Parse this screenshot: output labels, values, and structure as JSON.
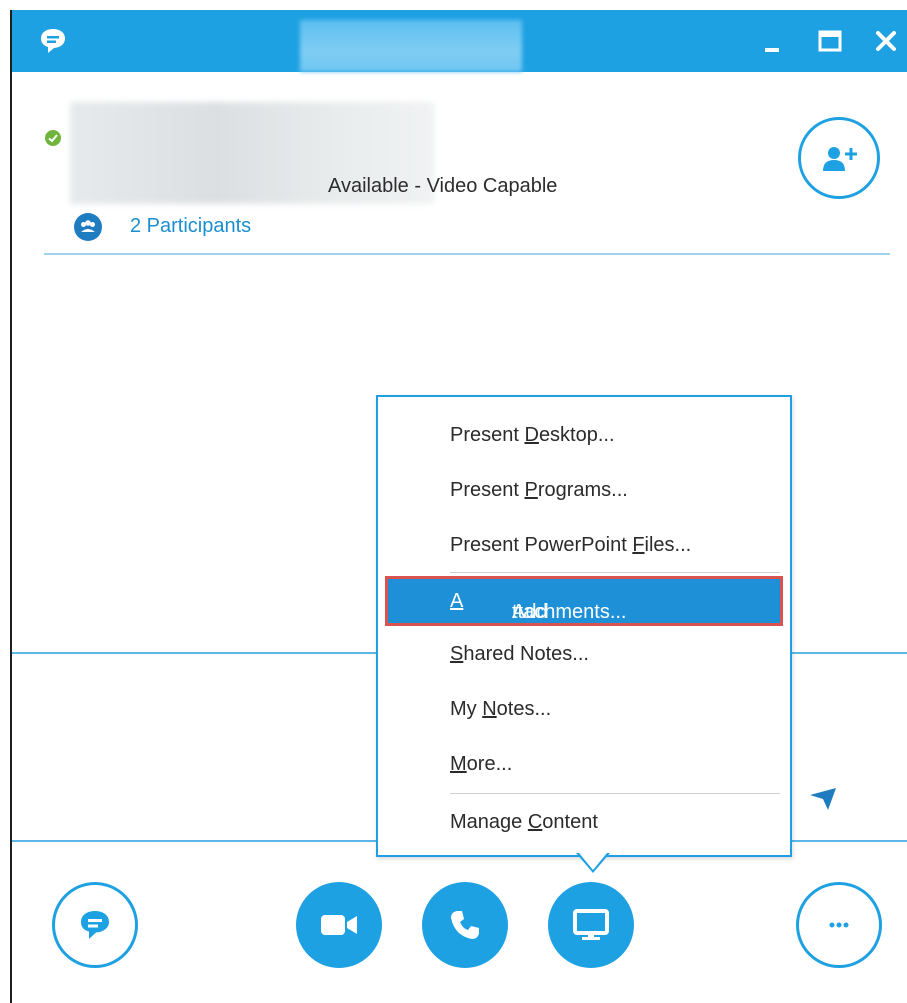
{
  "contact": {
    "status": "Available - Video Capable",
    "participants": "2 Participants"
  },
  "menu": {
    "items": [
      {
        "pre": "Present ",
        "key": "D",
        "post": "esktop..."
      },
      {
        "pre": "Present ",
        "key": "P",
        "post": "rograms..."
      },
      {
        "pre": "Present PowerPoint ",
        "key": "F",
        "post": "iles..."
      },
      {
        "pre": "Add ",
        "key": "A",
        "post": "ttachments..."
      },
      {
        "pre": "",
        "key": "S",
        "post": "hared Notes..."
      },
      {
        "pre": "My ",
        "key": "N",
        "post": "otes..."
      },
      {
        "pre": "",
        "key": "M",
        "post": "ore..."
      },
      {
        "pre": "Manage ",
        "key": "C",
        "post": "ontent"
      }
    ]
  },
  "colors": {
    "accent": "#1ea1e2",
    "highlight": "#1e90d8",
    "highlight_border": "#d9534f",
    "presence": "#6fb43b"
  },
  "icons": [
    "chat-bubble-icon",
    "minimize-icon",
    "maximize-icon",
    "close-icon",
    "add-person-icon",
    "participants-icon",
    "send-icon",
    "video-icon",
    "phone-icon",
    "present-monitor-icon",
    "more-ellipsis-icon"
  ]
}
